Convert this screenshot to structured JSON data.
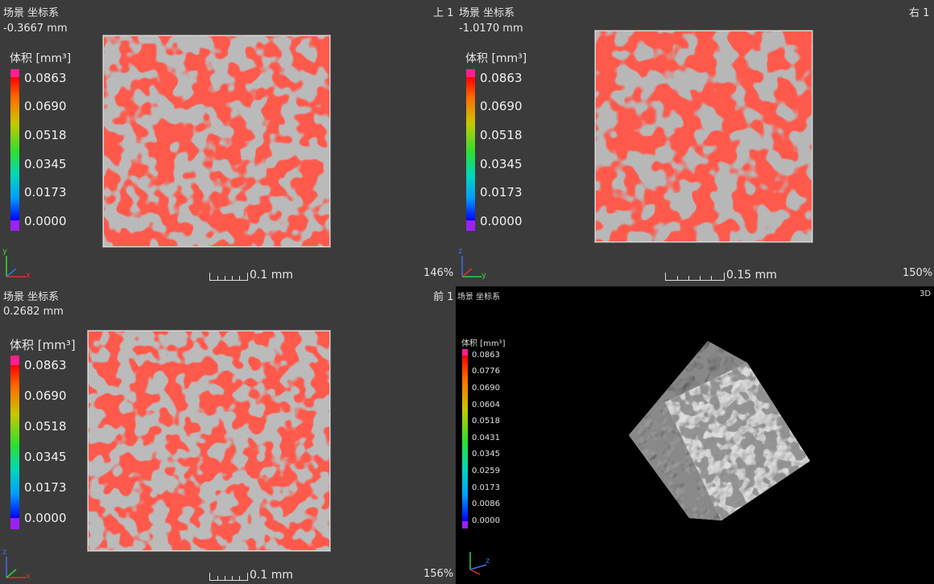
{
  "views": [
    {
      "coord_label": "场景 坐标系",
      "offset": "-0.3667 mm",
      "view_name": "上 1",
      "legend": {
        "title": "体积 [mm³]",
        "ticks": [
          "0.0863",
          "0.0690",
          "0.0518",
          "0.0345",
          "0.0173",
          "0.0000"
        ]
      },
      "scale_label": "0.1 mm",
      "zoom": "146%"
    },
    {
      "coord_label": "场景 坐标系",
      "offset": "-1.0170 mm",
      "view_name": "右 1",
      "legend": {
        "title": "体积 [mm³]",
        "ticks": [
          "0.0863",
          "0.0690",
          "0.0518",
          "0.0345",
          "0.0173",
          "0.0000"
        ]
      },
      "scale_label": "0.15 mm",
      "zoom": "150%"
    },
    {
      "coord_label": "场景 坐标系",
      "offset": "0.2682 mm",
      "view_name": "前 1",
      "legend": {
        "title": "体积 [mm³]",
        "ticks": [
          "0.0863",
          "0.0690",
          "0.0518",
          "0.0345",
          "0.0173",
          "0.0000"
        ]
      },
      "scale_label": "0.1 mm",
      "zoom": "156%"
    },
    {
      "coord_label": "场景 坐标系",
      "view_name": "3D",
      "legend": {
        "title": "体积 [mm³]",
        "ticks": [
          "0.0863",
          "0.0776",
          "0.0690",
          "0.0604",
          "0.0518",
          "0.0431",
          "0.0345",
          "0.0259",
          "0.0173",
          "0.0086",
          "0.0000"
        ]
      }
    }
  ],
  "axes": {
    "x": "x",
    "y": "y",
    "z": "z"
  },
  "colors": {
    "pore_red": "#ff1a12",
    "material_gray": "#b8b8b8",
    "legend_top": "#ff1e8c",
    "legend_bottom": "#9b22f2",
    "background_2d": "#3b3b3b",
    "background_3d": "#000000"
  }
}
